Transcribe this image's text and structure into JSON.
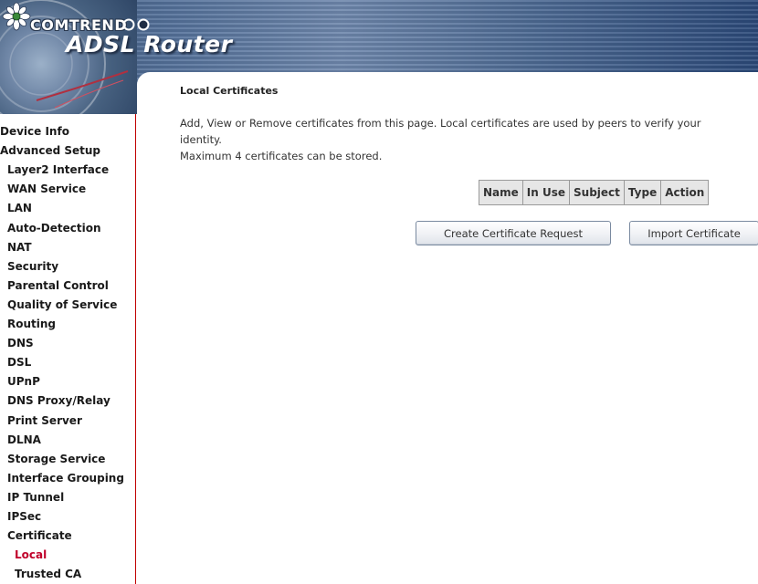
{
  "header": {
    "brand": "COMTREND",
    "product": "ADSL Router"
  },
  "sidebar": {
    "items": [
      {
        "label": "Device Info",
        "level": 0
      },
      {
        "label": "Advanced Setup",
        "level": 0
      },
      {
        "label": "Layer2 Interface",
        "level": 1
      },
      {
        "label": "WAN Service",
        "level": 1
      },
      {
        "label": "LAN",
        "level": 1
      },
      {
        "label": "Auto-Detection",
        "level": 1
      },
      {
        "label": "NAT",
        "level": 1
      },
      {
        "label": "Security",
        "level": 1
      },
      {
        "label": "Parental Control",
        "level": 1
      },
      {
        "label": "Quality of Service",
        "level": 1
      },
      {
        "label": "Routing",
        "level": 1
      },
      {
        "label": "DNS",
        "level": 1
      },
      {
        "label": "DSL",
        "level": 1
      },
      {
        "label": "UPnP",
        "level": 1
      },
      {
        "label": "DNS Proxy/Relay",
        "level": 1
      },
      {
        "label": "Print Server",
        "level": 1
      },
      {
        "label": "DLNA",
        "level": 1
      },
      {
        "label": "Storage Service",
        "level": 1
      },
      {
        "label": "Interface Grouping",
        "level": 1
      },
      {
        "label": "IP Tunnel",
        "level": 1
      },
      {
        "label": "IPSec",
        "level": 1
      },
      {
        "label": "Certificate",
        "level": 1
      },
      {
        "label": "Local",
        "level": 2,
        "active": true
      },
      {
        "label": "Trusted CA",
        "level": 2
      }
    ]
  },
  "main": {
    "title": "Local Certificates",
    "description_line1": "Add, View or Remove certificates from this page. Local certificates are used by peers to verify your identity.",
    "description_line2": "Maximum 4 certificates can be stored.",
    "table": {
      "columns": [
        "Name",
        "In Use",
        "Subject",
        "Type",
        "Action"
      ]
    },
    "buttons": {
      "create": "Create Certificate Request",
      "import": "Import Certificate"
    }
  },
  "colors": {
    "active_item": "#c0002a",
    "sidebar_border": "#c00000",
    "table_header_bg": "#e6e6e6"
  }
}
